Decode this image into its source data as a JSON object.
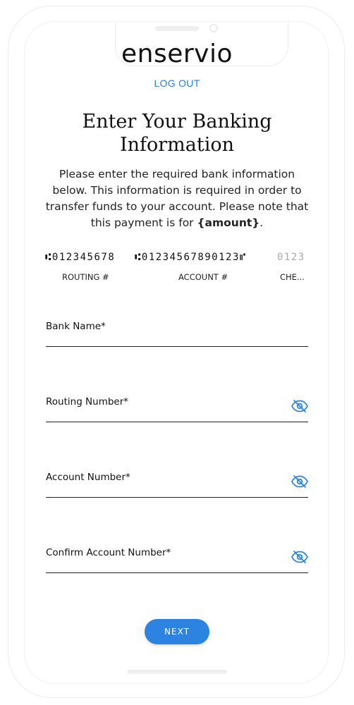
{
  "brand": {
    "logo_text": "enservio"
  },
  "header": {
    "logout_label": "LOG OUT"
  },
  "main": {
    "title": "Enter Your Banking Information",
    "intro_text": "Please enter the required bank information below. This information is required in order to transfer funds to your account. Please note that this payment is for ",
    "intro_amount": "{amount}",
    "intro_end": "."
  },
  "check_diagram": {
    "routing_digits": "⑆012345678",
    "account_digits": "⑆01234567890123⑈",
    "check_digits": "0123",
    "routing_label": "ROUTING #",
    "account_label": "ACCOUNT #",
    "check_label": "CHE..."
  },
  "form": {
    "bank_name_label": "Bank Name*",
    "routing_number_label": "Routing Number*",
    "account_number_label": "Account Number*",
    "confirm_account_label": "Confirm Account Number*",
    "next_label": "NEXT"
  },
  "icons": {
    "visibility_toggle": "eye-slash-icon"
  },
  "colors": {
    "accent": "#2d84e0",
    "link": "#2b7fd4"
  }
}
